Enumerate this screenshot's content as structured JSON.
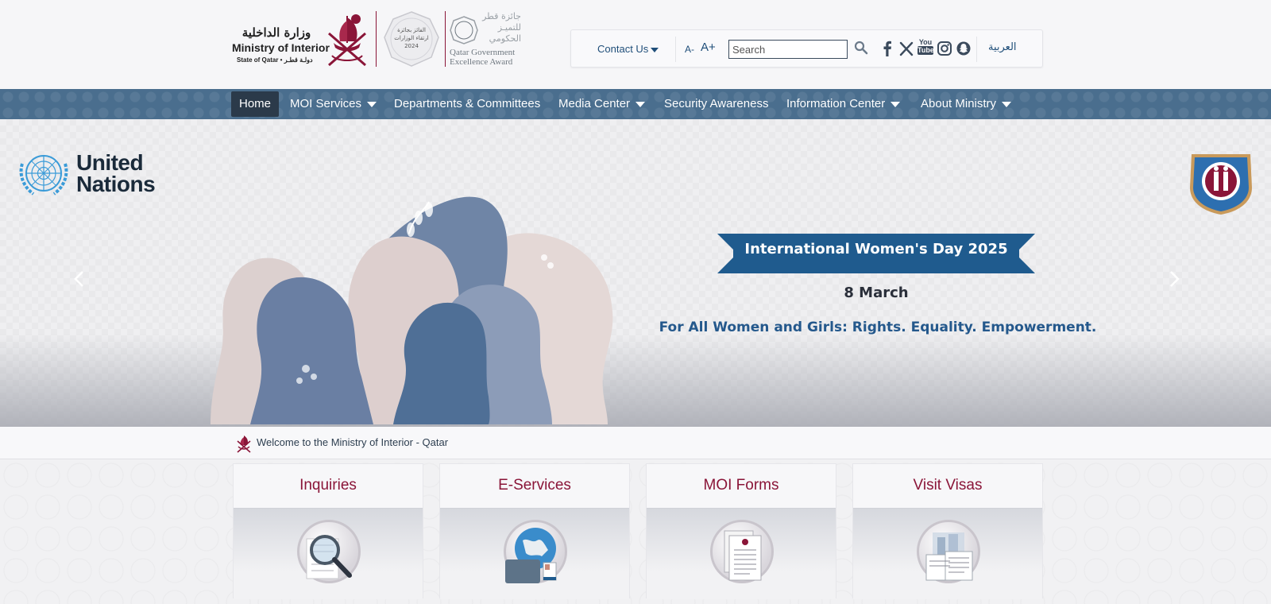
{
  "header": {
    "ministry_ar": "وزارة الداخلية",
    "ministry_en": "Ministry of Interior",
    "ministry_sub": "State of Qatar • دولـة قطـر",
    "award_badge_text": [
      "الفائز بجائزة",
      "ارتقاء الوزارات",
      "2024"
    ],
    "award_ar": [
      "جائزة قطر",
      "للتميـز",
      "الحكومي"
    ],
    "award_en": [
      "Qatar Government",
      "Excellence Award"
    ]
  },
  "toolbar": {
    "contact_label": "Contact Us",
    "font_decrease": "A-",
    "font_increase": "A+",
    "search_placeholder": "Search",
    "search_value": "",
    "social": [
      "facebook-icon",
      "x-icon",
      "youtube-icon",
      "instagram-icon",
      "snapchat-icon"
    ],
    "youtube_text": [
      "You",
      "Tube"
    ],
    "language_label": "العربية"
  },
  "nav": {
    "items": [
      {
        "label": "Home",
        "active": true,
        "dropdown": false
      },
      {
        "label": "MOI Services",
        "active": false,
        "dropdown": true
      },
      {
        "label": "Departments & Committees",
        "active": false,
        "dropdown": false
      },
      {
        "label": "Media Center",
        "active": false,
        "dropdown": true
      },
      {
        "label": "Security Awareness",
        "active": false,
        "dropdown": false
      },
      {
        "label": "Information Center",
        "active": false,
        "dropdown": true
      },
      {
        "label": "About Ministry",
        "active": false,
        "dropdown": true
      }
    ]
  },
  "banner": {
    "un_text_line1": "United",
    "un_text_line2": "Nations",
    "title": "International Women's Day 2025",
    "date": "8 March",
    "slogan": "For All Women and Girls: Rights. Equality. Empowerment."
  },
  "welcome": {
    "text": "Welcome to the Ministry of Interior - Qatar"
  },
  "cards": [
    {
      "title": "Inquiries",
      "icon": "magnifier-icon"
    },
    {
      "title": "E-Services",
      "icon": "globe-laptop-icon"
    },
    {
      "title": "MOI Forms",
      "icon": "forms-icon"
    },
    {
      "title": "Visit Visas",
      "icon": "visa-documents-icon"
    }
  ],
  "colors": {
    "brand_maroon": "#8a1538",
    "nav_blue": "#4a6e8e",
    "ribbon_blue": "#1f5b8e",
    "link_blue": "#1f4e79"
  }
}
